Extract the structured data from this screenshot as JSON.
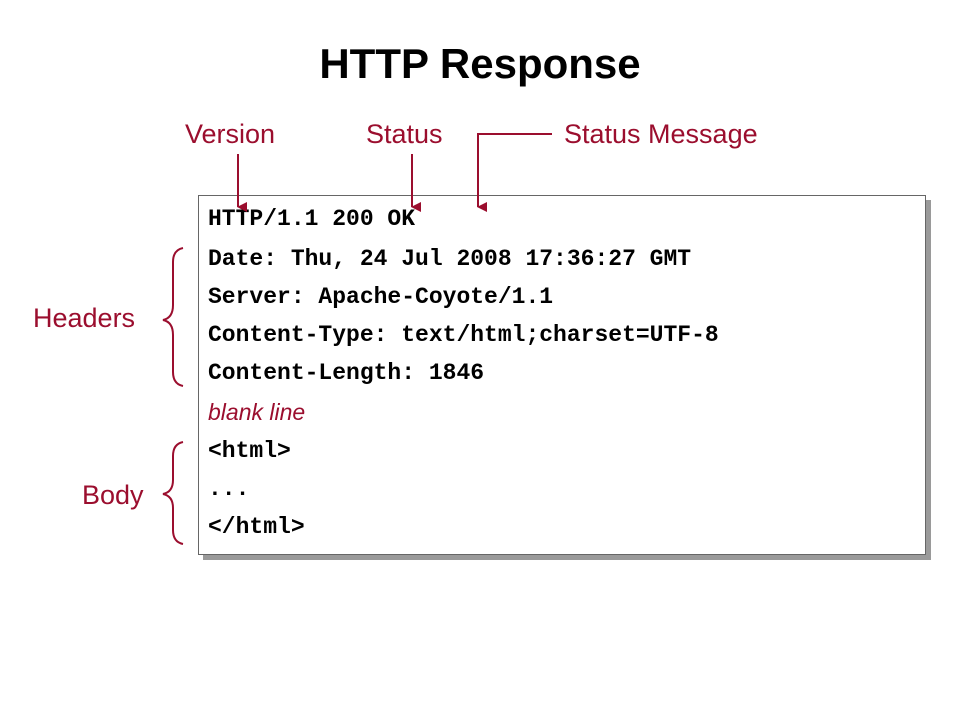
{
  "title": "HTTP Response",
  "labels": {
    "version": "Version",
    "status": "Status",
    "status_message": "Status Message",
    "headers": "Headers",
    "body": "Body"
  },
  "response": {
    "status_line": "HTTP/1.1 200 OK",
    "header_lines": [
      "Date: Thu, 24 Jul 2008 17:36:27 GMT",
      "Server: Apache-Coyote/1.1",
      "Content-Type: text/html;charset=UTF-8",
      "Content-Length: 1846"
    ],
    "blank_line": "blank line",
    "body_lines": [
      "<html>",
      "...",
      "</html>"
    ]
  },
  "colors": {
    "accent": "#9b0e2e",
    "text": "#000000",
    "shadow": "#9a9a9a"
  }
}
